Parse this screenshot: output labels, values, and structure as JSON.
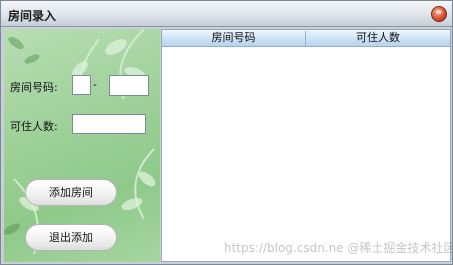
{
  "window": {
    "title": "房间录入"
  },
  "form": {
    "room_number_label": "房间号码:",
    "room_number_separator": "-",
    "room_number_part1": "",
    "room_number_part2": "",
    "capacity_label": "可住人数:",
    "capacity_value": "",
    "add_button_label": "添加房间",
    "exit_button_label": "退出添加"
  },
  "table": {
    "columns": [
      "房间号码",
      "可住人数"
    ],
    "rows": []
  },
  "watermark": "https://blog.csdn.ne  @稀土掘金技术社区",
  "colors": {
    "panel_green": "#9fd19a",
    "header_blue": "#cfe4f6",
    "close_red": "#d9502f"
  }
}
